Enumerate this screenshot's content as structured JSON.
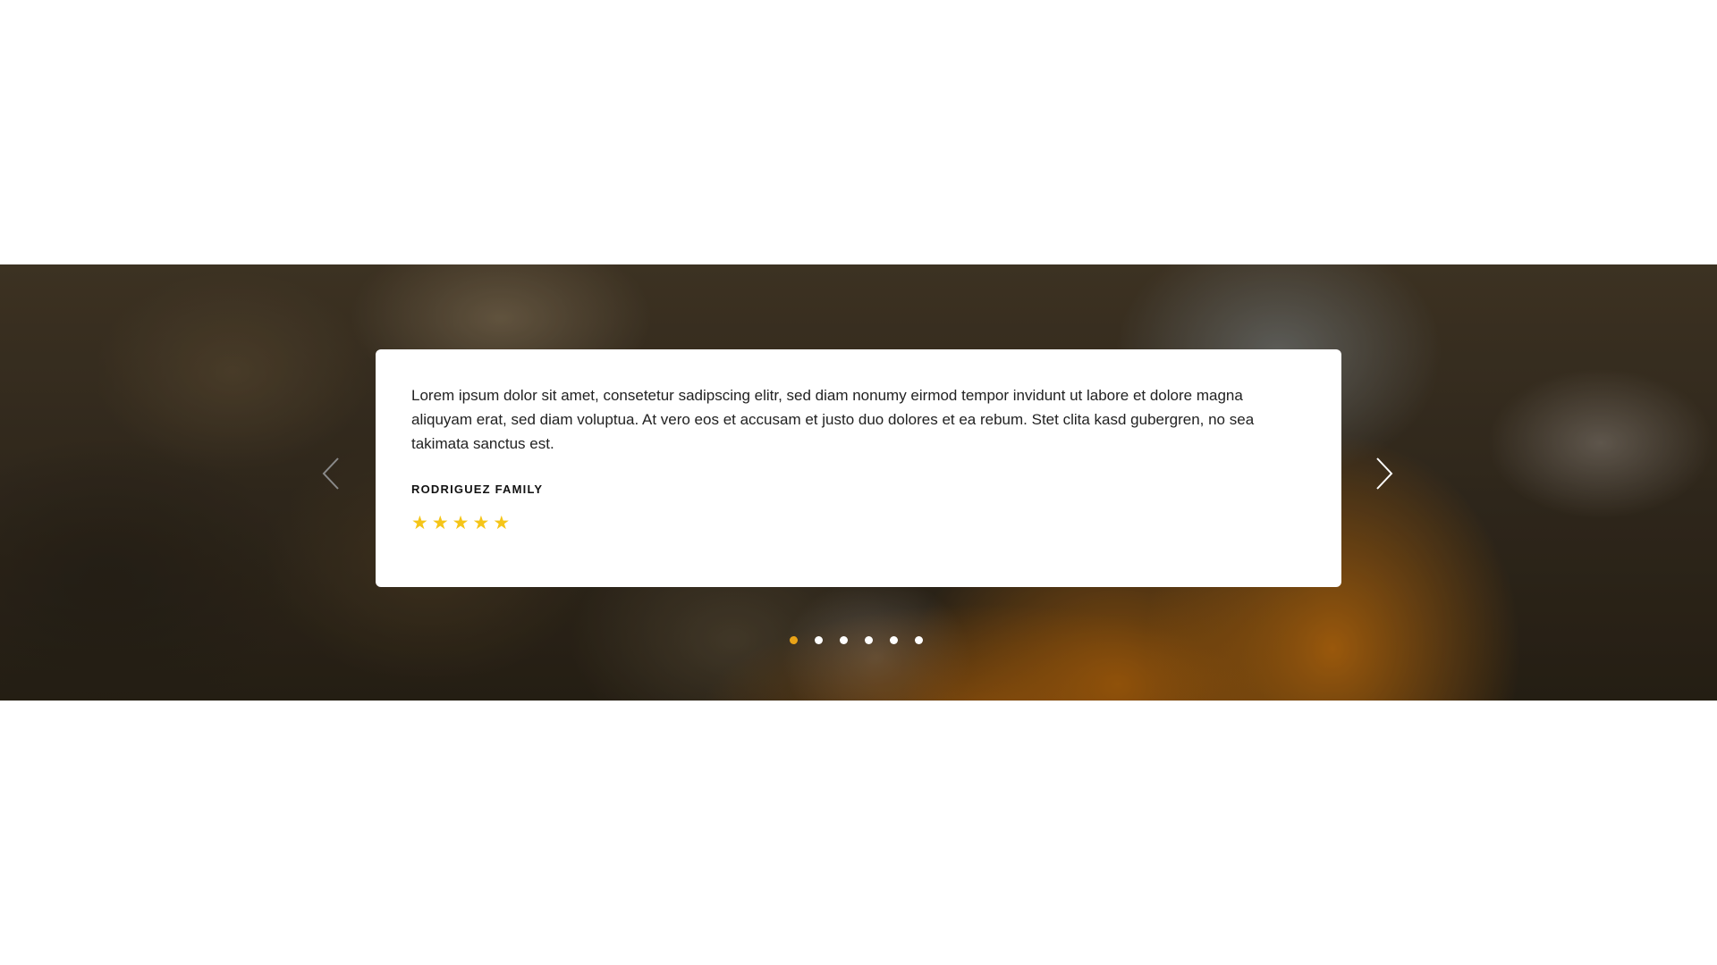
{
  "testimonial": {
    "quote": "Lorem ipsum dolor sit amet, consetetur sadipscing elitr, sed diam nonumy eirmod tempor invidunt ut labore et dolore magna aliquyam erat, sed diam voluptua. At vero eos et accusam et justo duo dolores et ea rebum. Stet clita kasd gubergren, no sea takimata sanctus est.",
    "author": "RODRIGUEZ FAMILY",
    "rating": 5,
    "star_glyph": "★"
  },
  "carousel": {
    "prev_icon": "chevron-left-icon",
    "next_icon": "chevron-right-icon",
    "slide_count": 6,
    "active_index": 0
  },
  "colors": {
    "star": "#f5c518",
    "active_dot": "#e9a317",
    "inactive_dot": "#ffffff",
    "prev_arrow": "#8a8a8a",
    "next_arrow": "#ffffff"
  }
}
